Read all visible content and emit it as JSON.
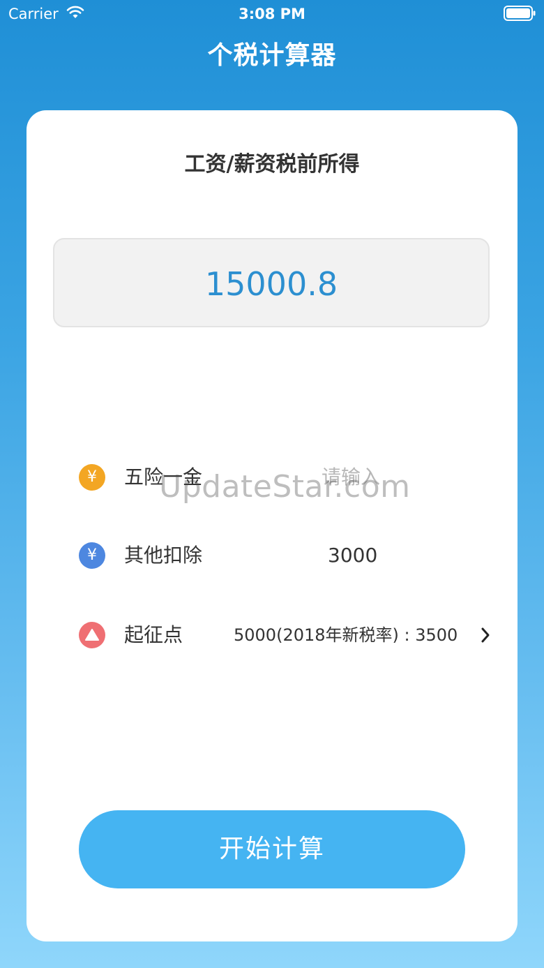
{
  "status_bar": {
    "carrier": "Carrier",
    "time": "3:08 PM"
  },
  "nav": {
    "title": "个税计算器"
  },
  "card": {
    "heading": "工资/薪资税前所得",
    "salary_value": "15000.8",
    "rows": {
      "insurance": {
        "icon_symbol": "¥",
        "label": "五险一金",
        "placeholder": "请输入"
      },
      "other_deductions": {
        "icon_symbol": "¥",
        "label": "其他扣除",
        "value": "3000"
      },
      "threshold": {
        "label": "起征点",
        "value": "5000(2018年新税率) : 3500"
      }
    },
    "calculate_button": "开始计算"
  },
  "watermark": "UpdateStar.com",
  "colors": {
    "accent": "#2c8fd0",
    "button": "#45b4f2",
    "icon_orange": "#f3a623",
    "icon_blue": "#4d87e0",
    "icon_red": "#ef6f73"
  },
  "icons": [
    "wifi-icon",
    "battery-icon",
    "yen-icon",
    "triangle-up-icon",
    "chevron-right-icon"
  ]
}
